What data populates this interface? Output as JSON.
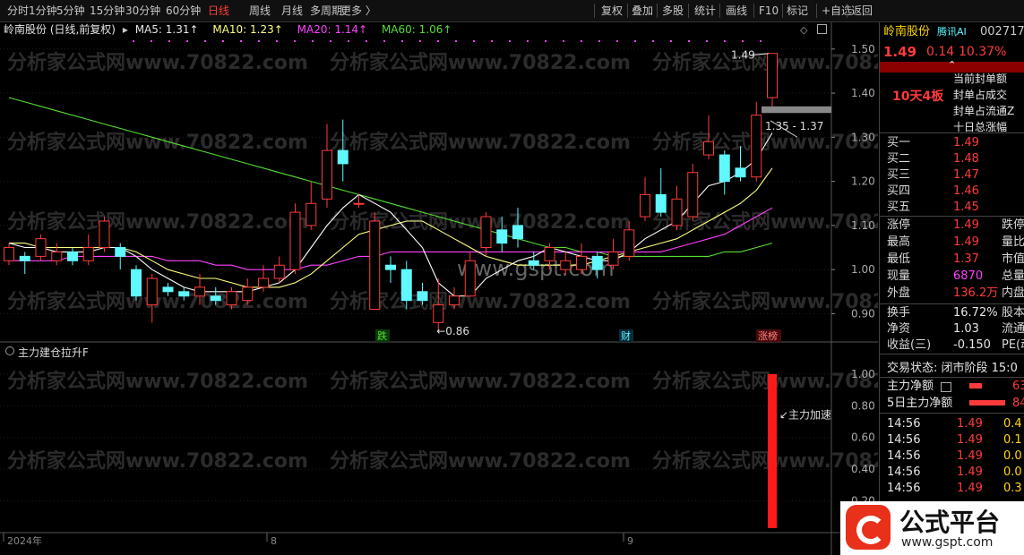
{
  "toolbar": {
    "periods": [
      "分时",
      "1分钟",
      "5分钟",
      "15分钟",
      "30分钟",
      "60分钟",
      "日线",
      "周线",
      "月线",
      "多周期",
      "更多 〉"
    ],
    "active_period": "日线",
    "actions": [
      "复权",
      "叠加",
      "多股",
      "统计",
      "画线",
      "F10",
      "标记",
      "+自选",
      "返回"
    ]
  },
  "chart": {
    "stock_label": "岭南股份 (日线,前复权)",
    "ma5_label": "MA5: 1.31↑",
    "ma10_label": "MA10: 1.23↑",
    "ma20_label": "MA20: 1.14↑",
    "ma60_label": "MA60: 1.06↑",
    "price_ticks": [
      "1.50",
      "1.40",
      "1.30",
      "1.20",
      "1.10",
      "1.00",
      "0.90"
    ],
    "high_annot": "1.49",
    "range_annot": "1.35 - 1.37",
    "low_annot": "←0.86",
    "event_markers": [
      "跌",
      "财",
      "涨榜"
    ],
    "sub_indicator": "主力建仓拉升F",
    "sub_ticks": [
      "1.00",
      "0.80",
      "0.60",
      "0.40",
      "0.20"
    ],
    "sub_annot": "↙主力加速",
    "date_labels": [
      "2024年",
      "8",
      "9"
    ],
    "watermark": "分析家公式网www.70822.com",
    "center_watermark": "www.gspt.com",
    "colors": {
      "up": "#ff3b3b",
      "down": "#5ff8ff",
      "ma5": "#ffffff",
      "ma10": "#ffff80",
      "ma20": "#ff40ff",
      "ma60": "#55dd33"
    }
  },
  "chart_data": {
    "type": "candlestick",
    "ylim": [
      0.84,
      1.53
    ],
    "candles": [
      [
        1.02,
        1.05,
        1.06,
        1.01
      ],
      [
        1.03,
        1.02,
        1.04,
        0.99
      ],
      [
        1.03,
        1.07,
        1.08,
        1.02
      ],
      [
        1.02,
        1.04,
        1.06,
        1.01
      ],
      [
        1.04,
        1.02,
        1.05,
        1.01
      ],
      [
        1.02,
        1.05,
        1.08,
        1.01
      ],
      [
        1.05,
        1.11,
        1.12,
        1.04
      ],
      [
        1.05,
        1.03,
        1.06,
        1.0
      ],
      [
        1.0,
        0.94,
        1.01,
        0.93
      ],
      [
        0.92,
        0.98,
        0.99,
        0.88
      ],
      [
        0.96,
        0.95,
        0.97,
        0.94
      ],
      [
        0.95,
        0.94,
        0.96,
        0.93
      ],
      [
        0.94,
        0.96,
        0.99,
        0.92
      ],
      [
        0.94,
        0.93,
        0.96,
        0.92
      ],
      [
        0.92,
        0.95,
        0.96,
        0.91
      ],
      [
        0.93,
        0.96,
        0.98,
        0.92
      ],
      [
        0.96,
        0.98,
        1.01,
        0.95
      ],
      [
        0.98,
        1.01,
        1.03,
        0.97
      ],
      [
        1.0,
        1.13,
        1.15,
        0.99
      ],
      [
        1.1,
        1.15,
        1.2,
        1.09
      ],
      [
        1.16,
        1.27,
        1.33,
        1.14
      ],
      [
        1.27,
        1.24,
        1.34,
        1.2
      ],
      [
        1.15,
        1.15,
        1.17,
        1.14
      ],
      [
        0.91,
        1.11,
        1.13,
        0.91
      ],
      [
        1.01,
        1.0,
        1.03,
        0.97
      ],
      [
        1.0,
        0.93,
        1.02,
        0.91
      ],
      [
        0.95,
        0.93,
        0.97,
        0.92
      ],
      [
        0.88,
        0.92,
        0.98,
        0.86
      ],
      [
        0.92,
        0.94,
        0.96,
        0.91
      ],
      [
        0.94,
        1.02,
        1.04,
        0.94
      ],
      [
        1.05,
        1.12,
        1.13,
        1.03
      ],
      [
        1.09,
        1.06,
        1.12,
        1.04
      ],
      [
        1.1,
        1.07,
        1.14,
        1.05
      ],
      [
        1.02,
        1.01,
        1.04,
        1.0
      ],
      [
        1.02,
        1.05,
        1.06,
        1.0
      ],
      [
        1.0,
        1.02,
        1.04,
        0.99
      ],
      [
        1.0,
        1.03,
        1.06,
        0.99
      ],
      [
        1.03,
        1.0,
        1.04,
        0.98
      ],
      [
        1.01,
        1.04,
        1.07,
        1.0
      ],
      [
        1.03,
        1.09,
        1.11,
        1.02
      ],
      [
        1.12,
        1.17,
        1.21,
        1.11
      ],
      [
        1.17,
        1.13,
        1.23,
        1.12
      ],
      [
        1.1,
        1.16,
        1.19,
        1.09
      ],
      [
        1.12,
        1.22,
        1.24,
        1.11
      ],
      [
        1.26,
        1.29,
        1.35,
        1.25
      ],
      [
        1.26,
        1.2,
        1.27,
        1.17
      ],
      [
        1.23,
        1.21,
        1.28,
        1.2
      ],
      [
        1.21,
        1.35,
        1.38,
        1.2
      ],
      [
        1.39,
        1.49,
        1.49,
        1.37
      ]
    ],
    "ma5": [
      1.06,
      1.05,
      1.05,
      1.04,
      1.04,
      1.04,
      1.05,
      1.05,
      1.03,
      1.0,
      0.98,
      0.96,
      0.95,
      0.95,
      0.95,
      0.95,
      0.96,
      0.97,
      1.0,
      1.05,
      1.1,
      1.14,
      1.17,
      1.15,
      1.13,
      1.09,
      1.05,
      0.97,
      0.94,
      0.94,
      0.98,
      1.0,
      1.02,
      1.03,
      1.05,
      1.04,
      1.03,
      1.02,
      1.02,
      1.04,
      1.07,
      1.09,
      1.11,
      1.15,
      1.19,
      1.2,
      1.22,
      1.25,
      1.31
    ],
    "ma10": [
      1.06,
      1.06,
      1.05,
      1.05,
      1.05,
      1.05,
      1.05,
      1.05,
      1.04,
      1.02,
      1.0,
      0.99,
      0.98,
      0.98,
      0.97,
      0.96,
      0.96,
      0.96,
      0.97,
      0.99,
      1.02,
      1.05,
      1.08,
      1.09,
      1.1,
      1.11,
      1.11,
      1.09,
      1.07,
      1.05,
      1.03,
      1.02,
      1.01,
      1.01,
      1.01,
      1.01,
      1.01,
      1.02,
      1.03,
      1.04,
      1.05,
      1.06,
      1.07,
      1.09,
      1.11,
      1.13,
      1.15,
      1.18,
      1.23
    ],
    "ma20": [
      1.02,
      1.02,
      1.02,
      1.02,
      1.03,
      1.03,
      1.03,
      1.03,
      1.03,
      1.03,
      1.02,
      1.02,
      1.02,
      1.01,
      1.01,
      1.0,
      1.0,
      1.0,
      1.0,
      1.01,
      1.01,
      1.02,
      1.03,
      1.03,
      1.04,
      1.04,
      1.04,
      1.04,
      1.04,
      1.04,
      1.04,
      1.04,
      1.04,
      1.04,
      1.04,
      1.04,
      1.04,
      1.04,
      1.04,
      1.04,
      1.04,
      1.04,
      1.05,
      1.06,
      1.07,
      1.08,
      1.1,
      1.12,
      1.14
    ],
    "ma60": [
      1.39,
      1.38,
      1.37,
      1.36,
      1.35,
      1.34,
      1.33,
      1.32,
      1.31,
      1.3,
      1.29,
      1.28,
      1.27,
      1.26,
      1.25,
      1.24,
      1.23,
      1.22,
      1.21,
      1.2,
      1.19,
      1.18,
      1.17,
      1.16,
      1.15,
      1.14,
      1.13,
      1.12,
      1.11,
      1.1,
      1.09,
      1.08,
      1.07,
      1.06,
      1.05,
      1.05,
      1.04,
      1.04,
      1.03,
      1.03,
      1.03,
      1.03,
      1.03,
      1.03,
      1.03,
      1.04,
      1.04,
      1.05,
      1.06
    ],
    "sub_series": {
      "name": "主力建仓拉升F",
      "ylim": [
        0,
        1.05
      ],
      "bar_index": 48,
      "bar_value": 1.0
    }
  },
  "right": {
    "name": "岭南股份",
    "source": "腾讯AI",
    "code": "002717",
    "price": "1.49",
    "change": "0.14",
    "pct": "10.37%",
    "streak": "10天4板",
    "info": [
      "当前封单额",
      "封单占成交",
      "封单占流通Z",
      "十日总涨幅"
    ],
    "bids": [
      {
        "l": "买一",
        "v": "1.49"
      },
      {
        "l": "买二",
        "v": "1.48"
      },
      {
        "l": "买三",
        "v": "1.47"
      },
      {
        "l": "买四",
        "v": "1.46"
      },
      {
        "l": "买五",
        "v": "1.45"
      }
    ],
    "stats": [
      {
        "l": "涨停",
        "v": "1.49",
        "l2": "跌停"
      },
      {
        "l": "最高",
        "v": "1.49",
        "l2": "量比"
      },
      {
        "l": "最低",
        "v": "1.37",
        "l2": "市值"
      },
      {
        "l": "现量",
        "v": "6870",
        "l2": "总量"
      },
      {
        "l": "外盘",
        "v": "136.2万",
        "l2": "内盘"
      }
    ],
    "fund": [
      {
        "l": "换手",
        "v": "16.72%",
        "l2": "股本"
      },
      {
        "l": "净资",
        "v": "1.03",
        "l2": "流通"
      },
      {
        "l": "收益(三)",
        "v": "-0.150",
        "l2": "PE(动"
      }
    ],
    "trade_status": "交易状态: 闭市阶段 15:0",
    "main_net": "主力净额",
    "main_net_val": "63",
    "main_net5": "5日主力净额",
    "main_net5_val": "84",
    "ticks": [
      {
        "t": "14:56",
        "p": "1.49",
        "v": "0.4"
      },
      {
        "t": "14:56",
        "p": "1.49",
        "v": "0.1"
      },
      {
        "t": "14:56",
        "p": "1.49",
        "v": "0.0"
      },
      {
        "t": "14:56",
        "p": "1.49",
        "v": "0.0"
      },
      {
        "t": "14:56",
        "p": "1.49",
        "v": "0.3"
      }
    ],
    "brand": "公式平台",
    "brand_url": "www.gspt.com"
  }
}
